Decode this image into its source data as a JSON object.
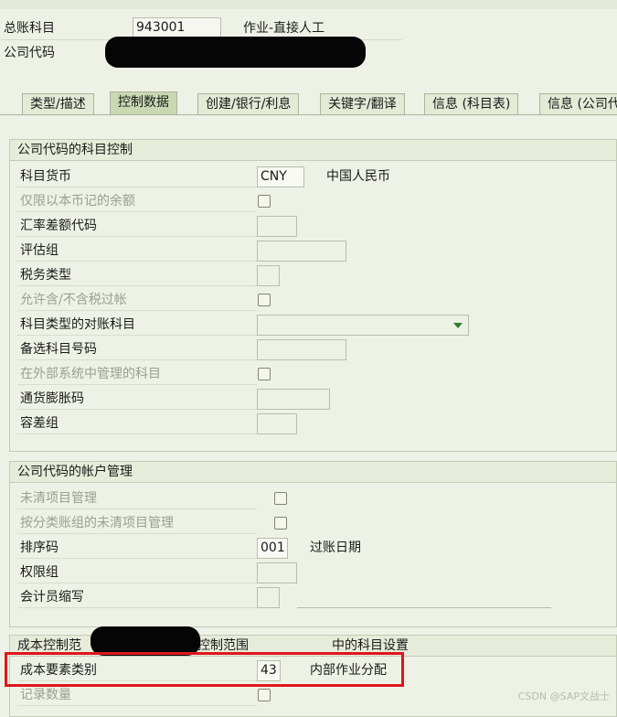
{
  "header": {
    "gl_account_label": "总账科目",
    "gl_account_value": "943001",
    "gl_account_desc": "作业-直接人工",
    "company_code_label": "公司代码"
  },
  "tabs": [
    {
      "label": "类型/描述"
    },
    {
      "label": "控制数据"
    },
    {
      "label": "创建/银行/利息"
    },
    {
      "label": "关键字/翻译"
    },
    {
      "label": "信息 (科目表)"
    },
    {
      "label": "信息 (公司代"
    }
  ],
  "group1": {
    "title": "公司代码的科目控制",
    "rows": [
      {
        "label": "科目货币",
        "value": "CNY",
        "desc": "中国人民币"
      },
      {
        "label": "仅限以本币记的余额"
      },
      {
        "label": "汇率差额代码"
      },
      {
        "label": "评估组"
      },
      {
        "label": "税务类型"
      },
      {
        "label": "允许含/不含税过帐"
      },
      {
        "label": "科目类型的对账科目"
      },
      {
        "label": "备选科目号码"
      },
      {
        "label": "在外部系统中管理的科目"
      },
      {
        "label": "通货膨胀码"
      },
      {
        "label": "容差组"
      }
    ]
  },
  "group2": {
    "title": "公司代码的帐户管理",
    "rows": [
      {
        "label": "未清项目管理"
      },
      {
        "label": "按分类账组的未清项目管理"
      },
      {
        "label": "排序码",
        "value": "001",
        "desc": "过账日期"
      },
      {
        "label": "权限组"
      },
      {
        "label": "会计员缩写"
      }
    ]
  },
  "group3": {
    "title_a": "成本控制范",
    "title_b": "控制范围",
    "title_c": "中的科目设置",
    "rows": [
      {
        "label": "成本要素类别",
        "value": "43",
        "desc": "内部作业分配"
      },
      {
        "label": "记录数量"
      }
    ]
  },
  "watermark": "CSDN @SAP文战士",
  "colors": {
    "highlight": "#e0161c",
    "dropdown_arrow": "#2e7d32",
    "redaction": "#050505"
  }
}
